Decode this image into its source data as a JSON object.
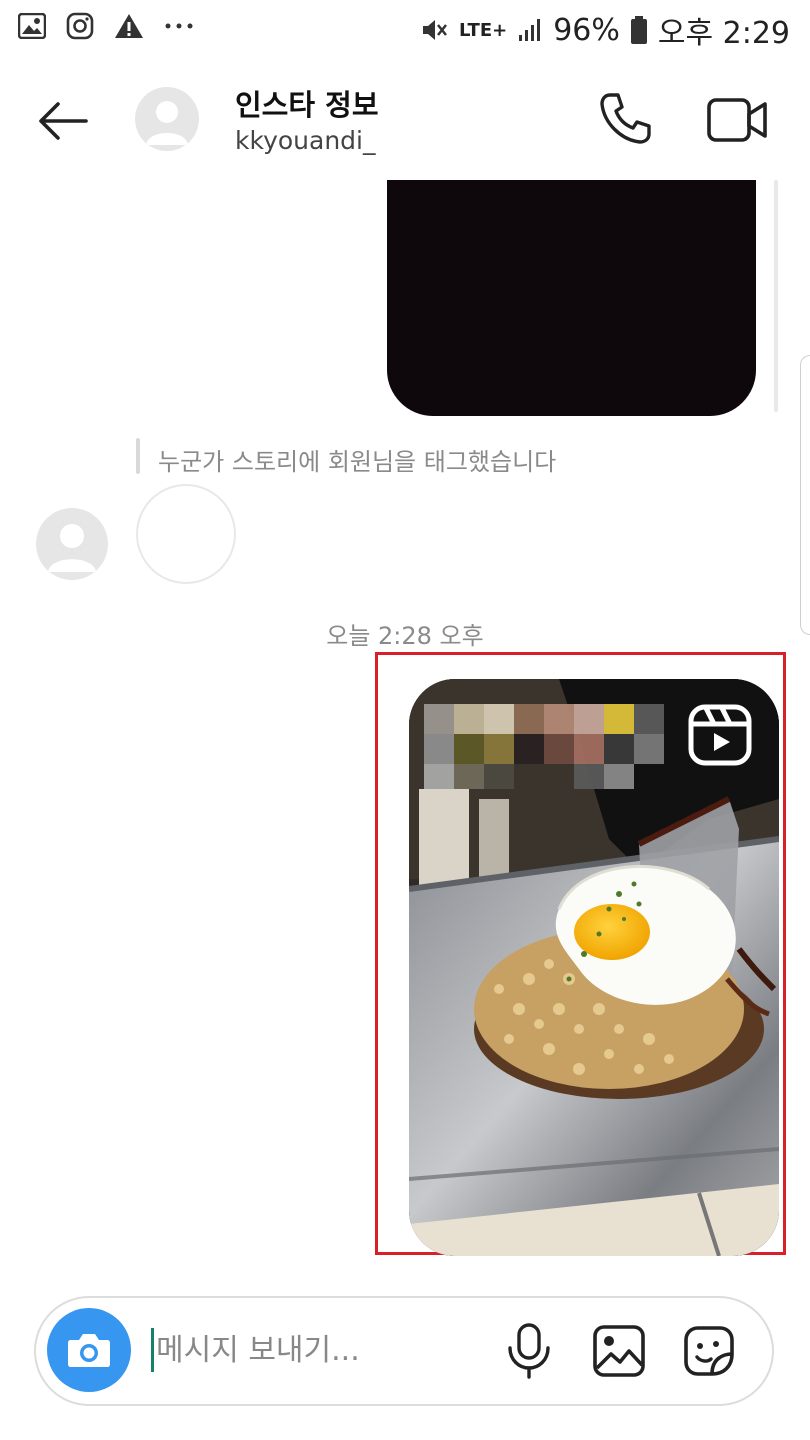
{
  "status_bar": {
    "battery": "96%",
    "network": "LTE+",
    "time": "오후 2:29",
    "icons": [
      "gallery-notification-icon",
      "instagram-notification-icon",
      "warning-icon",
      "more-dots-icon",
      "mute-icon",
      "signal-icon",
      "battery-icon"
    ]
  },
  "header": {
    "title": "인스타 정보",
    "username": "kkyouandi_"
  },
  "messages": {
    "story_mention": "누군가 스토리에 회원님을 태그했습니다",
    "timestamp": "오늘 2:28 오후"
  },
  "composer": {
    "placeholder": "메시지 보내기...",
    "value": ""
  },
  "colors": {
    "accent": "#3797f0",
    "highlight_border": "#d9202a",
    "dark_media": "#0e070c"
  }
}
